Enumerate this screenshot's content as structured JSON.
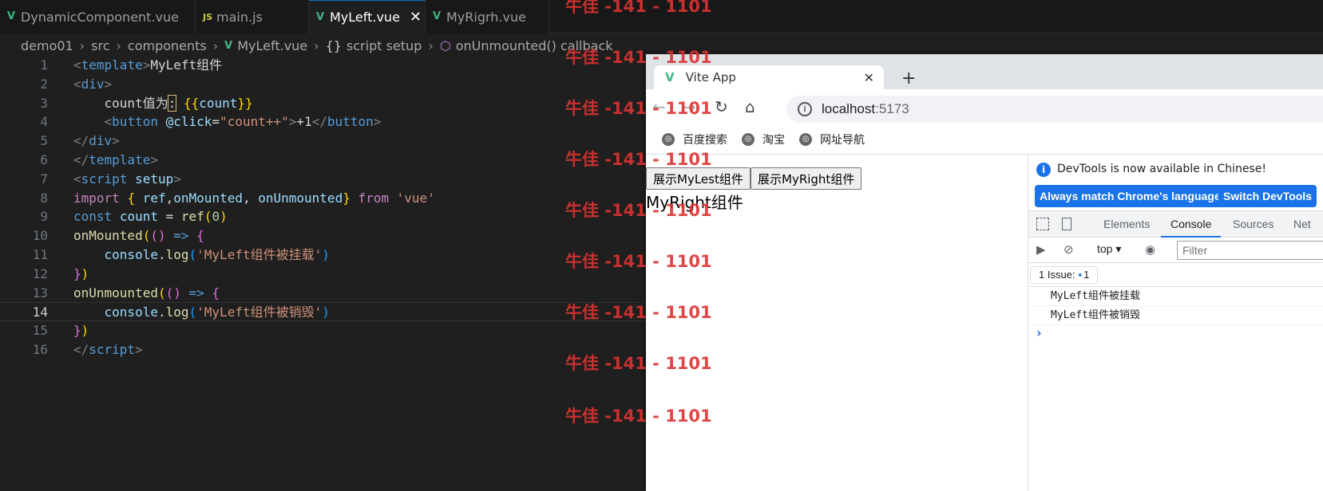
{
  "editor": {
    "tabs": [
      {
        "label": "DynamicComponent.vue",
        "icon": "vue-icon",
        "active": false
      },
      {
        "label": "main.js",
        "icon": "js-icon",
        "active": false
      },
      {
        "label": "MyLeft.vue",
        "icon": "vue-icon",
        "active": true
      },
      {
        "label": "MyRigrh.vue",
        "icon": "vue-icon",
        "active": false
      }
    ],
    "tab_close_glyph": "✕",
    "breadcrumb": [
      "demo01",
      "src",
      "components",
      "MyLeft.vue",
      "script setup",
      "onUnmounted() callback"
    ],
    "current_line": 14
  },
  "watermark": "牛佳 -141 - 1101",
  "browser": {
    "tab_title": "Vite App",
    "tab_close": "✕",
    "new_tab": "+",
    "address": {
      "host": "localhost",
      "port": ":5173"
    },
    "bookmarks": [
      "百度搜索",
      "淘宝",
      "网址导航"
    ],
    "page": {
      "buttons": [
        "展示MyLest组件",
        "展示MyRight组件"
      ],
      "text": "MyRight组件"
    }
  },
  "devtools": {
    "banner_message": "DevTools is now available in Chinese!",
    "banner_buttons": [
      "Always match Chrome's language",
      "Switch DevTools"
    ],
    "tabs": [
      "Elements",
      "Console",
      "Sources",
      "Net"
    ],
    "active_tab": "Console",
    "context": "top",
    "filter_placeholder": "Filter",
    "issues_label": "1 Issue:",
    "issues_count": "1",
    "console_logs": [
      "MyLeft组件被挂载",
      "MyLeft组件被销毁"
    ],
    "prompt": "›"
  },
  "colors": {
    "vue_green": "#41b883",
    "accent_blue": "#1a73e8",
    "watermark_red": "#dc3232"
  }
}
